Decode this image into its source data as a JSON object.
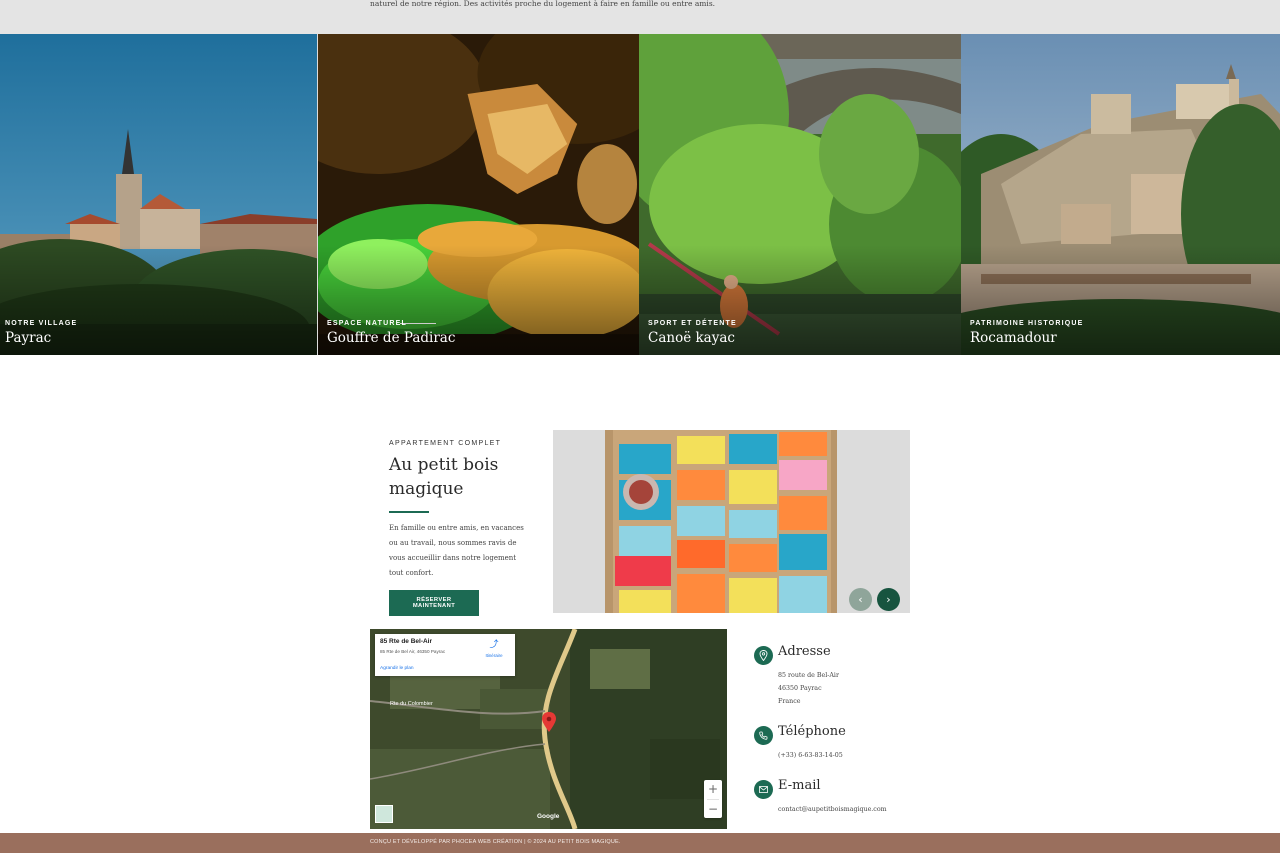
{
  "intro_text": "naturel de notre région. Des activités proche du logement à faire en famille ou entre amis.",
  "gallery": [
    {
      "kicker": "NOTRE VILLAGE",
      "title": "Payrac"
    },
    {
      "kicker": "ESPACE NATUREL",
      "title": "Gouffre de Padirac"
    },
    {
      "kicker": "SPORT ET DÉTENTE",
      "title": "Canoë kayac"
    },
    {
      "kicker": "PATRIMOINE HISTORIQUE",
      "title": "Rocamadour"
    }
  ],
  "apartment": {
    "eyebrow": "APPARTEMENT COMPLET",
    "title": "Au petit bois magique",
    "description": "En famille ou entre amis, en vacances ou au travail, nous sommes ravis de vous accueillir dans notre logement tout confort.",
    "cta_label": "RÉSERVER MAINTENANT"
  },
  "map": {
    "place_name": "85 Rte de Bel-Air",
    "place_address": "85 Rte de Bel Air, 46350 Payrac",
    "directions_label": "Itinéraire",
    "enlarge_label": "Agrandir le plan",
    "zoom_in": "+",
    "zoom_out": "−",
    "attribution": "Google",
    "road_label": "Rte du Colombier"
  },
  "contact": {
    "address": {
      "heading": "Adresse",
      "line1": "85 route de Bel-Air",
      "line2": "46350 Payrac",
      "line3": "France"
    },
    "phone": {
      "heading": "Téléphone",
      "line1": "(+33) 6-63-83-14-05"
    },
    "email": {
      "heading": "E-mail",
      "line1": "contact@aupetitboismagique.com"
    }
  },
  "footer": "CONÇU ET DÉVELOPPÉ PAR PHOCEA WEB CRÉATION | © 2024 AU PETIT BOIS MAGIQUE.",
  "colors": {
    "accent": "#1c6a53",
    "footer": "#9a6f5d",
    "top_band": "#e4e4e4"
  },
  "icons": {
    "slider_prev": "chevron-left-icon",
    "slider_next": "chevron-right-icon",
    "address": "map-pin-icon",
    "phone": "phone-icon",
    "email": "mail-icon"
  }
}
